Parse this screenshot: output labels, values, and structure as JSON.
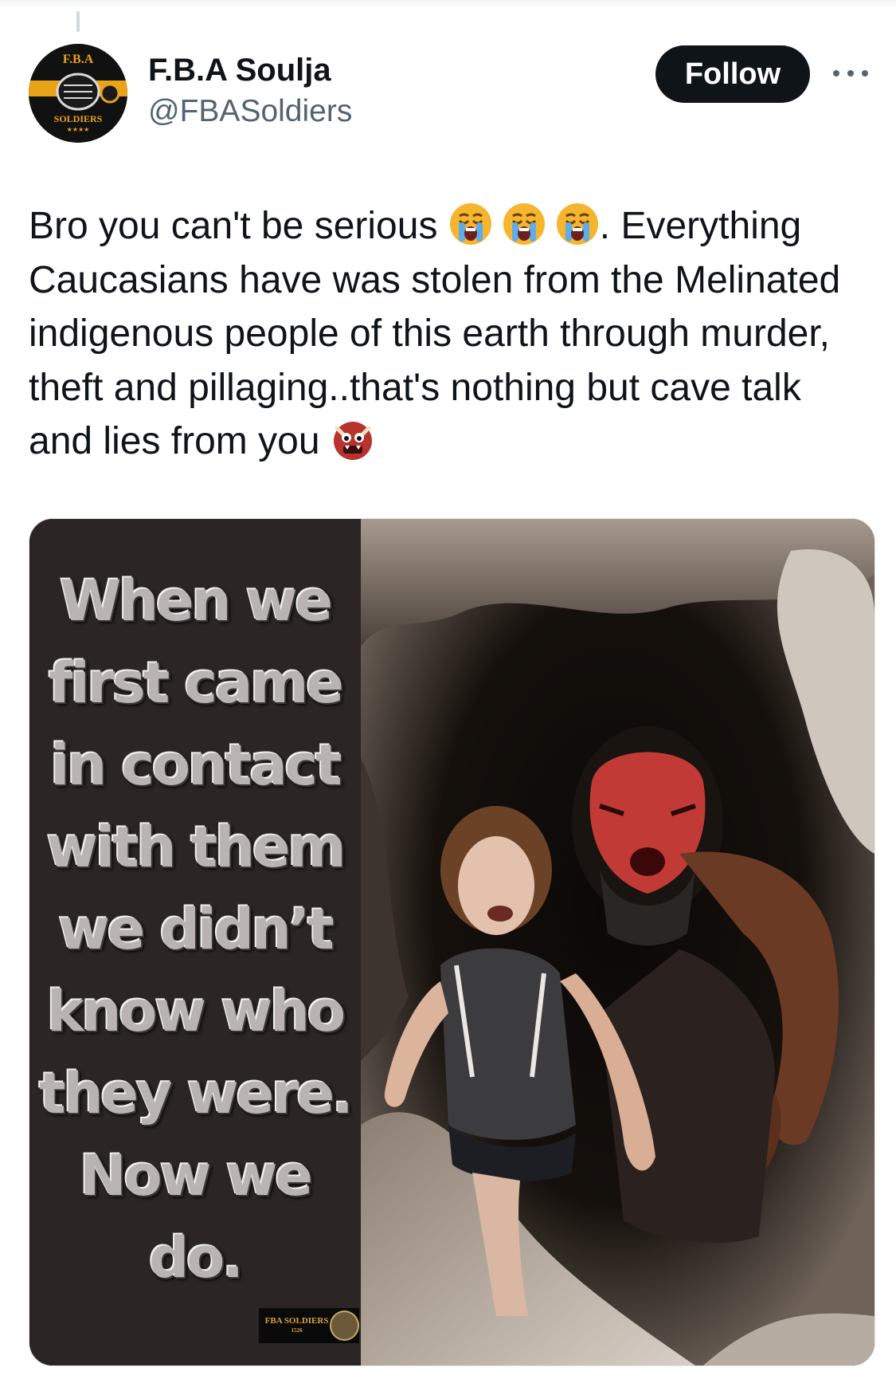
{
  "tweet": {
    "author": {
      "display_name": "F.B.A Soulja",
      "handle": "@FBASoldiers",
      "avatar_text_top": "F.B.A",
      "avatar_text_bottom": "SOLDIERS"
    },
    "follow_label": "Follow",
    "more_icon": "more-horizontal-icon",
    "text_lines": [
      "Bro you can't be serious",
      ". Everything",
      "Caucasians have was stolen from the Melinated",
      "indigenous people of this earth through murder,",
      "theft and pillaging..that's nothing but cave talk",
      "and lies from you"
    ],
    "emojis": [
      "loudly-crying-face",
      "loudly-crying-face",
      "loudly-crying-face",
      "ogre"
    ],
    "media": {
      "quote_lines": [
        "When we",
        "first came",
        "in contact",
        "with them",
        "we didn’t",
        "know who",
        "they were.",
        "Now we",
        "do."
      ],
      "watermark_line1": "FBA SOLDIERS",
      "watermark_line2": "1526"
    }
  }
}
